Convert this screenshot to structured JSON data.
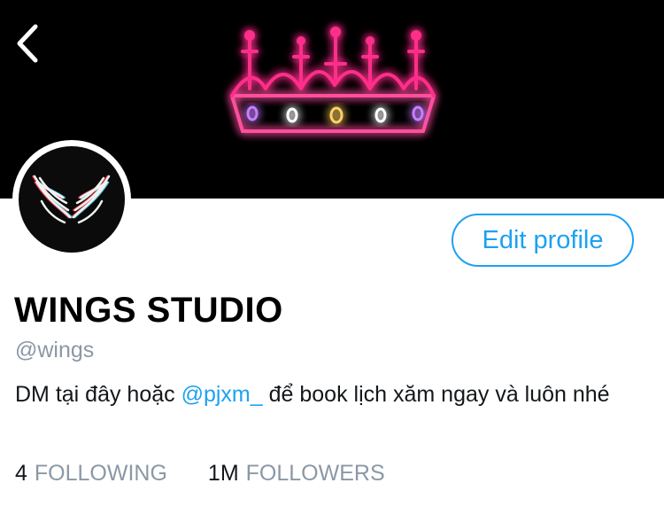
{
  "header": {
    "back_icon": "chevron-left-icon",
    "banner_icon": "neon-crown-icon"
  },
  "profile": {
    "avatar_icon": "wings-logo-icon",
    "edit_button_label": "Edit profile",
    "display_name": "WINGS STUDIO",
    "handle": "@wings",
    "bio_before": "DM tại đây hoặc ",
    "bio_mention": "@pjxm_",
    "bio_after": " để book lịch xăm ngay và luôn nhé"
  },
  "stats": {
    "following_count": "4",
    "following_label": "FOLLOWING",
    "followers_count": "1M",
    "followers_label": "FOLLOWERS"
  },
  "colors": {
    "accent": "#1da1f2",
    "secondary_text": "#8b98a5",
    "banner_bg": "#000000",
    "neon_pink": "#ff2e8a"
  }
}
